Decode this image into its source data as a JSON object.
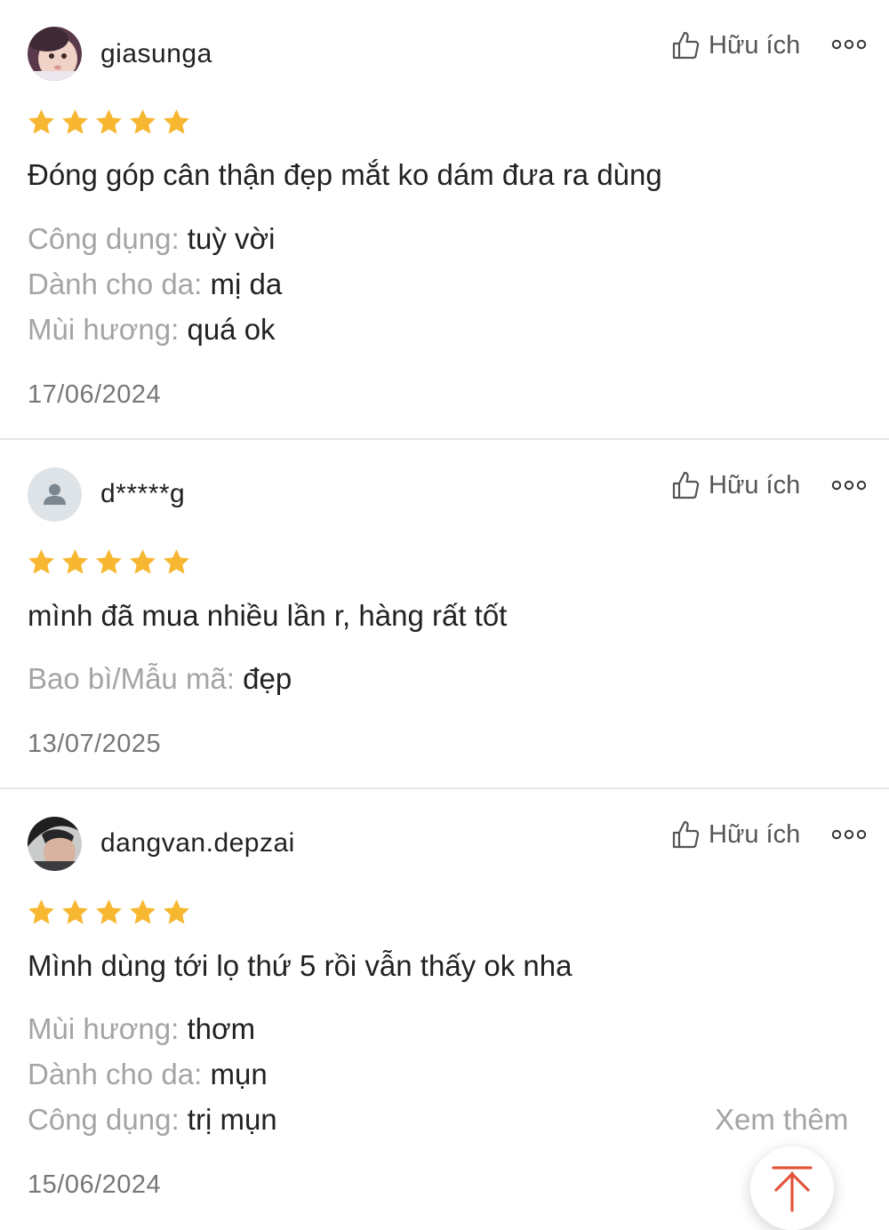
{
  "reviews": [
    {
      "username": "giasunga",
      "avatar": "baby-photo-avatar",
      "rating": 5,
      "helpful_label": "Hữu ích",
      "content": "Đóng góp cân thận đẹp mắt ko dám đưa ra dùng",
      "attributes": [
        {
          "label": "Công dụng:",
          "value": " tuỳ vời"
        },
        {
          "label": "Dành cho da:",
          "value": " mị da"
        },
        {
          "label": "Mùi hương:",
          "value": " quá ok"
        }
      ],
      "date": "17/06/2024"
    },
    {
      "username": "d*****g",
      "avatar": "default-person-avatar",
      "rating": 5,
      "helpful_label": "Hữu ích",
      "content": "mình đã mua nhiều lần r, hàng rất tốt",
      "attributes": [
        {
          "label": "Bao bì/Mẫu mã:",
          "value": " đẹp"
        }
      ],
      "date": "13/07/2025"
    },
    {
      "username": "dangvan.depzai",
      "avatar": "man-photo-avatar",
      "rating": 5,
      "helpful_label": "Hữu ích",
      "content": "Mình dùng tới lọ thứ 5 rồi vẫn thấy ok nha",
      "attributes": [
        {
          "label": "Mùi hương:",
          "value": " thơm"
        },
        {
          "label": "Dành cho da:",
          "value": " mụn"
        },
        {
          "label": "Công dụng:",
          "value": " trị mụn"
        }
      ],
      "see_more": "Xem thêm",
      "date": "15/06/2024"
    }
  ],
  "icons": {
    "thumb": "thumbs-up-icon",
    "more": "more-dots-icon",
    "star": "star-icon",
    "scroll_top": "arrow-up-icon"
  },
  "colors": {
    "star": "#F7B731",
    "scroll_top_arrow": "#E2543A",
    "muted": "#A4A4A4",
    "text": "#222222"
  }
}
